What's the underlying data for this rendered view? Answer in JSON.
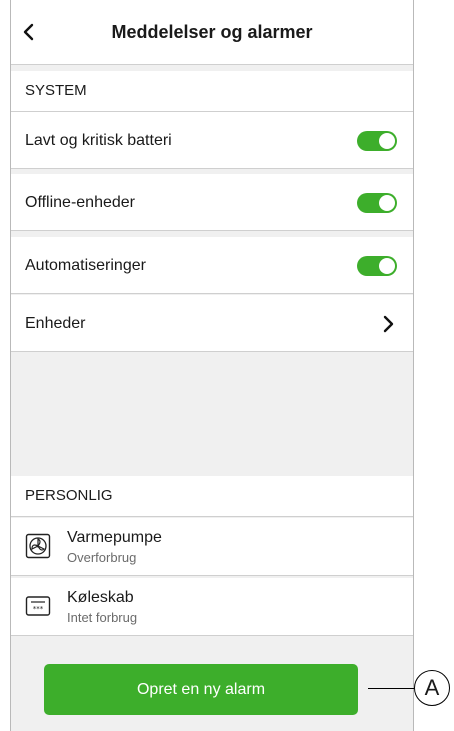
{
  "header": {
    "title": "Meddelelser og alarmer",
    "back_icon": "chevron-left-icon"
  },
  "system": {
    "label": "SYSTEM",
    "toggles": [
      {
        "label": "Lavt og kritisk batteri",
        "on": true
      },
      {
        "label": "Offline-enheder",
        "on": true
      },
      {
        "label": "Automatiseringer",
        "on": true
      }
    ],
    "link": {
      "label": "Enheder",
      "icon": "chevron-right-icon"
    }
  },
  "personal": {
    "label": "PERSONLIG",
    "devices": [
      {
        "name": "Varmepumpe",
        "status": "Overforbrug",
        "icon": "heat-pump-icon"
      },
      {
        "name": "Køleskab",
        "status": "Intet forbrug",
        "icon": "fridge-icon"
      }
    ]
  },
  "cta": {
    "label": "Opret en ny alarm"
  },
  "callout": {
    "label": "A"
  },
  "colors": {
    "accent": "#3dae2b",
    "background": "#f0f0f0"
  }
}
